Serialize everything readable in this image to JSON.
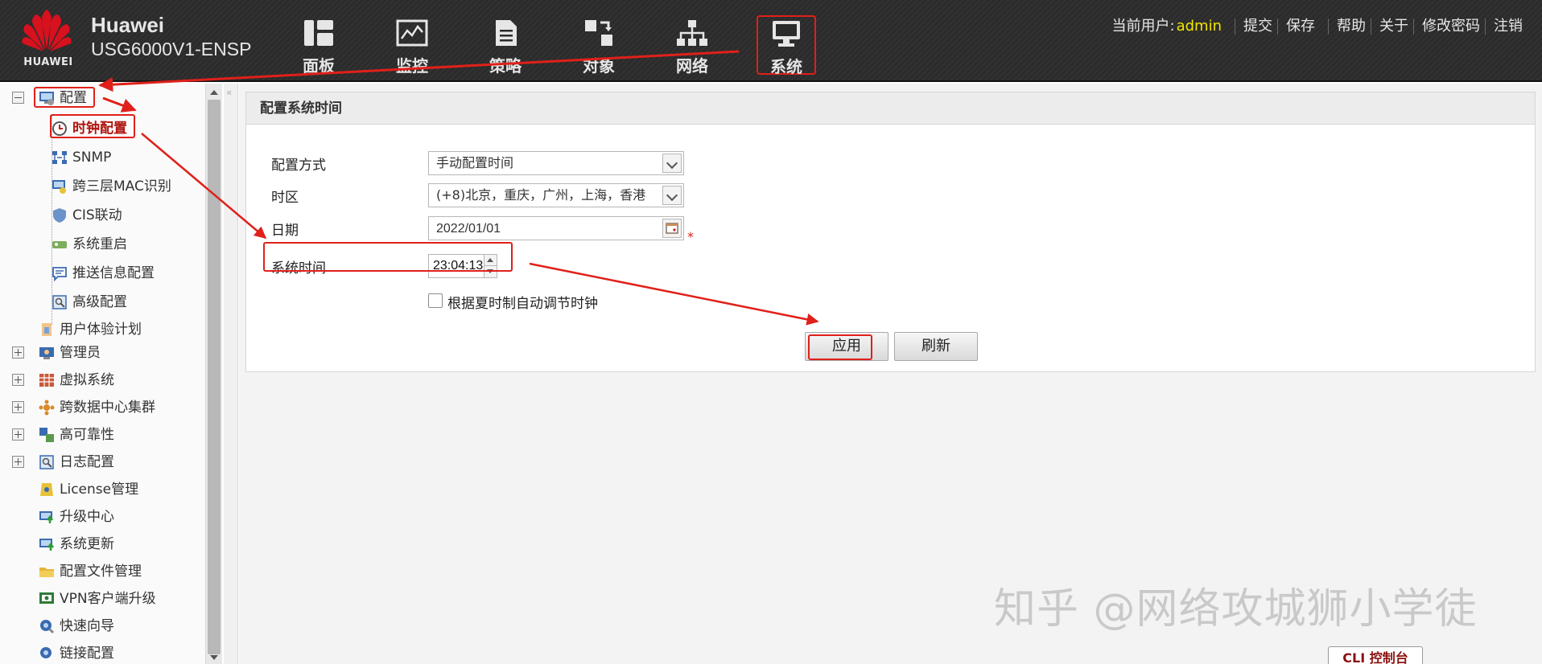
{
  "brand": {
    "logo_text": "HUAWEI",
    "title": "Huawei",
    "model": "USG6000V1-ENSP"
  },
  "nav": {
    "items": [
      {
        "label": "面板",
        "icon": "dashboard-icon"
      },
      {
        "label": "监控",
        "icon": "monitor-chart-icon"
      },
      {
        "label": "策略",
        "icon": "policy-document-icon"
      },
      {
        "label": "对象",
        "icon": "object-icon"
      },
      {
        "label": "网络",
        "icon": "network-topology-icon"
      },
      {
        "label": "系统",
        "icon": "system-computer-icon"
      }
    ],
    "active": "系统"
  },
  "user_bar": {
    "current_user_label": "当前用户:",
    "username": "admin",
    "submit": "提交",
    "save": "保存",
    "help": "帮助",
    "about": "关于",
    "change_password": "修改密码",
    "logout": "注销"
  },
  "sidebar": {
    "config_group": "配置",
    "config_children": [
      "时钟配置",
      "SNMP",
      "跨三层MAC识别",
      "CIS联动",
      "系统重启",
      "推送信息配置",
      "高级配置"
    ],
    "items": [
      "用户体验计划",
      "管理员",
      "虚拟系统",
      "跨数据中心集群",
      "高可靠性",
      "日志配置",
      "License管理",
      "升级中心",
      "系统更新",
      "配置文件管理",
      "VPN客户端升级",
      "快速向导",
      "链接配置"
    ]
  },
  "form": {
    "title": "配置系统时间",
    "mode_label": "配置方式",
    "mode_value": "手动配置时间",
    "timezone_label": "时区",
    "timezone_value": "(+8)北京，重庆，广州，上海，香港",
    "date_label": "日期",
    "date_value": "2022/01/01",
    "required_mark": "*",
    "time_label": "系统时间",
    "time_value": "23:04:13",
    "dst_label": "根据夏时制自动调节时钟",
    "apply": "应用",
    "refresh": "刷新"
  },
  "watermark": "知乎 @网络攻城狮小学徒",
  "cli_console": "CLI 控制台",
  "colors": {
    "header_bg": "#2b2b2b",
    "highlight": "#e0201a",
    "username": "#f3e400"
  }
}
